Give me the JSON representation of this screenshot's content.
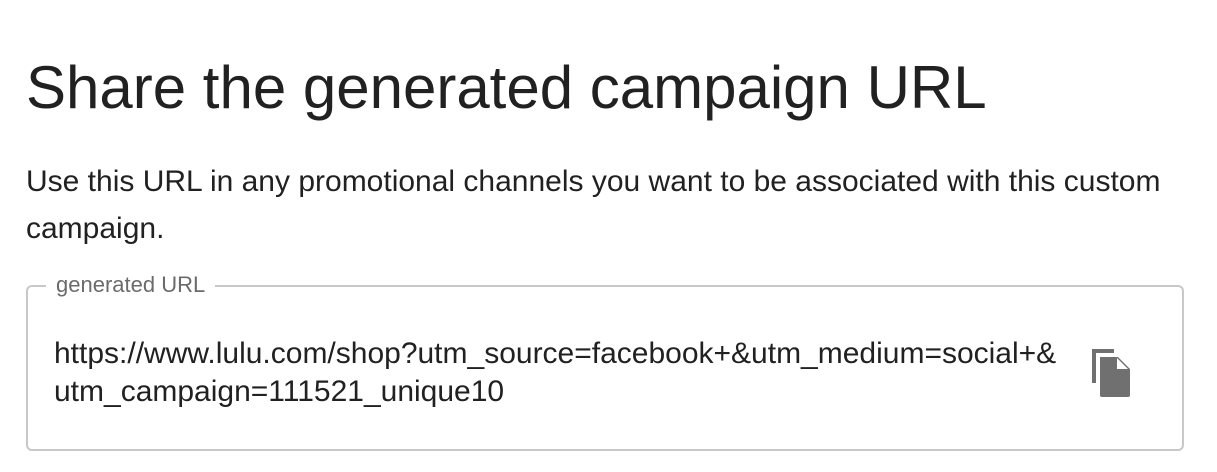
{
  "heading": "Share the generated campaign URL",
  "description": "Use this URL in any promotional channels you want to be associated with this custom campaign.",
  "url_field": {
    "label": "generated URL",
    "value": "https://www.lulu.com/shop?utm_source=facebook+&utm_medium=social+&utm_campaign=111521_unique10",
    "copy_icon": "copy-icon"
  },
  "colors": {
    "text": "#212121",
    "label": "#6b6b6b",
    "border": "#c8c8c8",
    "icon": "#707070"
  }
}
